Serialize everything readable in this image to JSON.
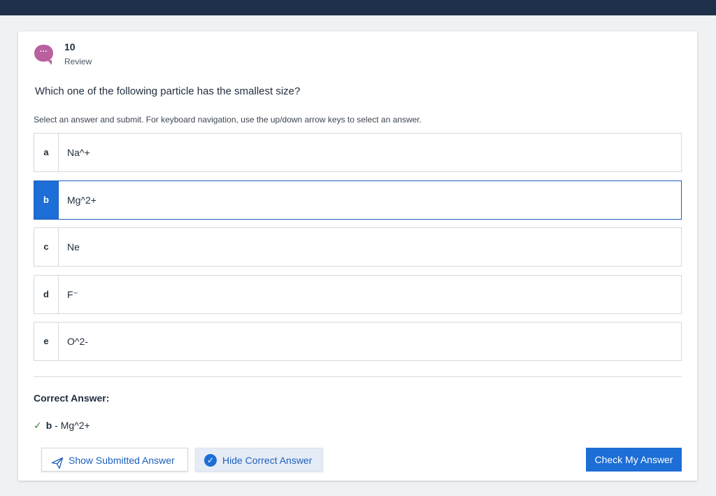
{
  "question": {
    "number": "10",
    "status": "Review",
    "text": "Which one of the following particle has the smallest size?",
    "instructions": "Select an answer and submit. For keyboard navigation, use the up/down arrow keys to select an answer."
  },
  "options": [
    {
      "letter": "a",
      "text": "Na^+",
      "selected": false
    },
    {
      "letter": "b",
      "text": "Mg^2+",
      "selected": true
    },
    {
      "letter": "c",
      "text": "Ne",
      "selected": false
    },
    {
      "letter": "d",
      "text": "F⁻",
      "selected": false
    },
    {
      "letter": "e",
      "text": "O^2-",
      "selected": false
    }
  ],
  "correct_answer": {
    "label": "Correct Answer:",
    "letter": "b",
    "separator": " - ",
    "text": "Mg^2+"
  },
  "buttons": {
    "show_submitted": "Show Submitted Answer",
    "hide_correct": "Hide Correct Answer",
    "check": "Check My Answer"
  },
  "icons": {
    "avatar": "chat-bubble-icon",
    "correct": "checkmark-icon",
    "show_submitted": "paper-plane-icon",
    "hide_correct": "check-circle-icon"
  },
  "colors": {
    "topbar": "#1e3049",
    "accent": "#1d6ed6",
    "avatar": "#b9609f",
    "correct": "#2f8a3a"
  }
}
